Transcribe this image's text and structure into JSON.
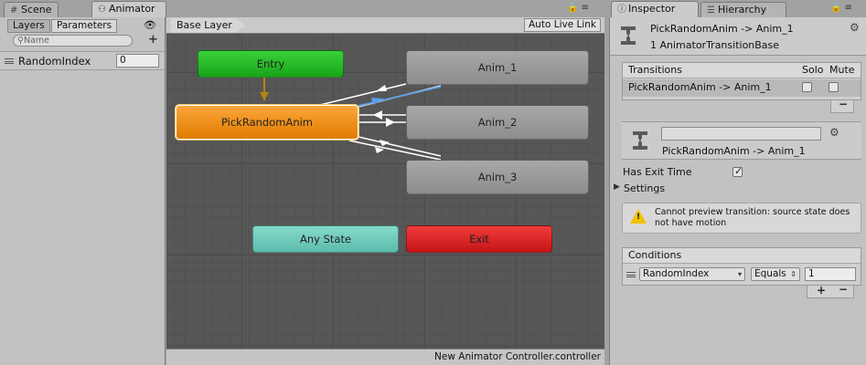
{
  "left_tabs": {
    "scene": "Scene",
    "animator": "Animator"
  },
  "right_tabs": {
    "inspector": "Inspector",
    "hierarchy": "Hierarchy"
  },
  "parameters_panel": {
    "tabs": {
      "layers": "Layers",
      "parameters": "Parameters"
    },
    "search_placeholder": "Name",
    "parameters": [
      {
        "name": "RandomIndex",
        "value": "0"
      }
    ]
  },
  "graph": {
    "layer": "Base Layer",
    "auto_live_link": "Auto Live Link",
    "controller": "New Animator Controller.controller",
    "nodes": {
      "entry": "Entry",
      "pick": "PickRandomAnim",
      "anim1": "Anim_1",
      "anim2": "Anim_2",
      "anim3": "Anim_3",
      "any_state": "Any State",
      "exit": "Exit"
    }
  },
  "inspector": {
    "header_title": "PickRandomAnim -> Anim_1",
    "header_subtitle": "1 AnimatorTransitionBase",
    "transitions_label": "Transitions",
    "solo_label": "Solo",
    "mute_label": "Mute",
    "transitions": [
      {
        "name": "PickRandomAnim -> Anim_1",
        "solo": false,
        "mute": false
      }
    ],
    "transition_name_value": "",
    "transition_label": "PickRandomAnim -> Anim_1",
    "has_exit_time_label": "Has Exit Time",
    "has_exit_time": true,
    "settings_label": "Settings",
    "warning": "Cannot preview transition: source state does not have motion",
    "conditions_label": "Conditions",
    "conditions": [
      {
        "parameter": "RandomIndex",
        "mode": "Equals",
        "value": "1"
      }
    ]
  }
}
